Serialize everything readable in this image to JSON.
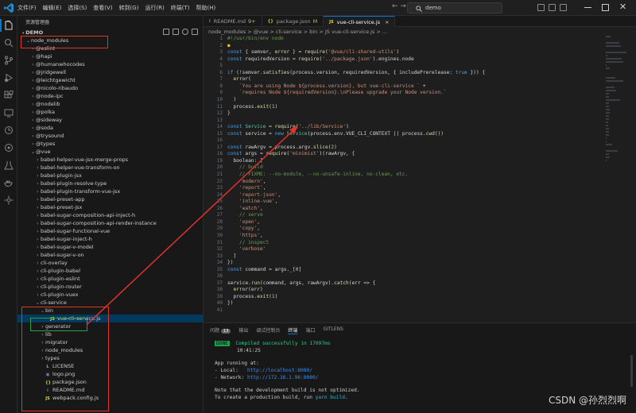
{
  "titlebar": {
    "menu": [
      "文件(F)",
      "编辑(E)",
      "选择(S)",
      "查看(V)",
      "转到(G)",
      "运行(R)",
      "终端(T)",
      "帮助(H)"
    ],
    "search": "demo"
  },
  "sidebar": {
    "title": "资源管理器",
    "project": "DEMO",
    "items": [
      {
        "label": "node_modules",
        "indent": 1,
        "chevron": "down"
      },
      {
        "label": "@eslint",
        "indent": 2,
        "chevron": "right"
      },
      {
        "label": "@hapi",
        "indent": 2,
        "chevron": "right"
      },
      {
        "label": "@humanwhocodes",
        "indent": 2,
        "chevron": "right"
      },
      {
        "label": "@jridgewell",
        "indent": 2,
        "chevron": "right"
      },
      {
        "label": "@leichtgewicht",
        "indent": 2,
        "chevron": "right"
      },
      {
        "label": "@nicolo-ribaudo",
        "indent": 2,
        "chevron": "right"
      },
      {
        "label": "@node-ipc",
        "indent": 2,
        "chevron": "right"
      },
      {
        "label": "@nodelib",
        "indent": 2,
        "chevron": "right"
      },
      {
        "label": "@polka",
        "indent": 2,
        "chevron": "right"
      },
      {
        "label": "@sideway",
        "indent": 2,
        "chevron": "right"
      },
      {
        "label": "@soda",
        "indent": 2,
        "chevron": "right"
      },
      {
        "label": "@trysound",
        "indent": 2,
        "chevron": "right"
      },
      {
        "label": "@types",
        "indent": 2,
        "chevron": "right"
      },
      {
        "label": "@vue",
        "indent": 2,
        "chevron": "down"
      },
      {
        "label": "babel-helper-vue-jsx-merge-props",
        "indent": 3,
        "chevron": "right"
      },
      {
        "label": "babel-helper-vue-transform-on",
        "indent": 3,
        "chevron": "right"
      },
      {
        "label": "babel-plugin-jsx",
        "indent": 3,
        "chevron": "right"
      },
      {
        "label": "babel-plugin-resolve-type",
        "indent": 3,
        "chevron": "right"
      },
      {
        "label": "babel-plugin-transform-vue-jsx",
        "indent": 3,
        "chevron": "right"
      },
      {
        "label": "babel-preset-app",
        "indent": 3,
        "chevron": "right"
      },
      {
        "label": "babel-preset-jsx",
        "indent": 3,
        "chevron": "right"
      },
      {
        "label": "babel-sugar-composition-api-inject-h",
        "indent": 3,
        "chevron": "right"
      },
      {
        "label": "babel-sugar-composition-api-render-instance",
        "indent": 3,
        "chevron": "right"
      },
      {
        "label": "babel-sugar-functional-vue",
        "indent": 3,
        "chevron": "right"
      },
      {
        "label": "babel-sugar-inject-h",
        "indent": 3,
        "chevron": "right"
      },
      {
        "label": "babel-sugar-v-model",
        "indent": 3,
        "chevron": "right"
      },
      {
        "label": "babel-sugar-v-on",
        "indent": 3,
        "chevron": "right"
      },
      {
        "label": "cli-overlay",
        "indent": 3,
        "chevron": "right"
      },
      {
        "label": "cli-plugin-babel",
        "indent": 3,
        "chevron": "right"
      },
      {
        "label": "cli-plugin-eslint",
        "indent": 3,
        "chevron": "right"
      },
      {
        "label": "cli-plugin-router",
        "indent": 3,
        "chevron": "right"
      },
      {
        "label": "cli-plugin-vuex",
        "indent": 3,
        "chevron": "right"
      },
      {
        "label": "cli-service",
        "indent": 3,
        "chevron": "down"
      },
      {
        "label": "bin",
        "indent": 4,
        "chevron": "down"
      },
      {
        "label": "vue-cli-service.js",
        "indent": 5,
        "chevron": "",
        "icon": "JS",
        "selected": true
      },
      {
        "label": "generator",
        "indent": 4,
        "chevron": "right"
      },
      {
        "label": "lib",
        "indent": 4,
        "chevron": "right"
      },
      {
        "label": "migrator",
        "indent": 4,
        "chevron": "right"
      },
      {
        "label": "node_modules",
        "indent": 4,
        "chevron": "right"
      },
      {
        "label": "types",
        "indent": 4,
        "chevron": "right"
      },
      {
        "label": "LICENSE",
        "indent": 4,
        "chevron": "",
        "icon": "L"
      },
      {
        "label": "logo.png",
        "indent": 4,
        "chevron": "",
        "icon": "▣"
      },
      {
        "label": "package.json",
        "indent": 4,
        "chevron": "",
        "icon": "{}"
      },
      {
        "label": "README.md",
        "indent": 4,
        "chevron": "",
        "icon": "i"
      },
      {
        "label": "webpack.config.js",
        "indent": 4,
        "chevron": "",
        "icon": "JS"
      }
    ]
  },
  "tabs": [
    {
      "label": "README.md",
      "mod": "9+",
      "icon": "i"
    },
    {
      "label": "package.json",
      "mod": "M",
      "icon": "{}"
    },
    {
      "label": "vue-cli-service.js",
      "mod": "",
      "icon": "JS",
      "active": true
    }
  ],
  "breadcrumb": "node_modules > @vue > cli-service > bin > JS vue-cli-service.js > ...",
  "editor": {
    "lines": [
      "#!/usr/bin/env node",
      "",
      "const { semver, error } = require('@vue/cli-shared-utils')",
      "const requiredVersion = require('../package.json').engines.node",
      "",
      "if (!semver.satisfies(process.version, requiredVersion, { includePrerelease: true })) {",
      "  error(",
      "    `You are using Node ${process.version}, but vue-cli-service ` +",
      "    `requires Node ${requiredVersion}.\\nPlease upgrade your Node version.`",
      "  )",
      "  process.exit(1)",
      "}",
      "",
      "const Service = require('../lib/Service')",
      "const service = new Service(process.env.VUE_CLI_CONTEXT || process.cwd())",
      "",
      "const rawArgv = process.argv.slice(2)",
      "const args = require('minimist')(rawArgv, {",
      "  boolean: [",
      "    // build",
      "    // FIXME: --no-module, --no-unsafe-inline, no-clean, etc.",
      "    'modern',",
      "    'report',",
      "    'report-json',",
      "    'inline-vue',",
      "    'watch',",
      "    // serve",
      "    'open',",
      "    'copy',",
      "    'https',",
      "    // inspect",
      "    'verbose'",
      "  ]",
      "})",
      "const command = args._[0]",
      "",
      "service.run(command, args, rawArgv).catch(err => {",
      "  error(err)",
      "  process.exit(1)",
      "})",
      ""
    ]
  },
  "panel": {
    "tabs": [
      "问题",
      "输出",
      "调试控制台",
      "终端",
      "端口",
      "GITLENS"
    ],
    "problems_count": "13",
    "active": "终端"
  },
  "terminal": {
    "done": "DONE",
    "compiled": "Compiled successfully in 17097ms",
    "time": "10:41:25",
    "app_running": "App running at:",
    "local_label": "- Local:   ",
    "local_url": "http://localhost:8080/",
    "network_label": "- Network: ",
    "network_url": "http://172.16.1.96:8080/",
    "note1": "Note that the development build is not optimized.",
    "note2_a": "To create a production build, run ",
    "note2_b": "yarn build",
    "note2_c": "."
  },
  "watermark": "CSDN @孙烈烈啊",
  "colors": {
    "accent": "#0078d4",
    "annotation_red": "#e0332b",
    "annotation_green": "#2ea043",
    "keyword": "#569cd6",
    "string": "#ce9178",
    "comment": "#6a9955",
    "variable": "#9cdcfe",
    "function": "#dcdcaa",
    "class": "#4ec9b0",
    "number": "#b5cea8"
  }
}
